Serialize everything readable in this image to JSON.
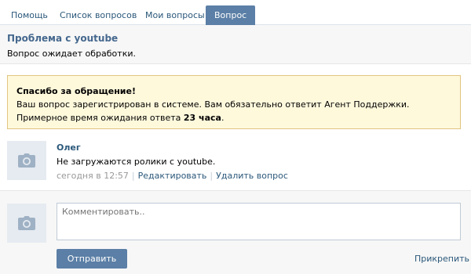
{
  "tabs": [
    {
      "label": "Помощь"
    },
    {
      "label": "Список вопросов"
    },
    {
      "label": "Мои вопросы"
    },
    {
      "label": "Вопрос"
    }
  ],
  "question": {
    "title": "Проблема с youtube",
    "status": "Вопрос ожидает обработки."
  },
  "notice": {
    "title": "Спасибо за обращение!",
    "line1": "Ваш вопрос зарегистрирован в системе. Вам обязательно ответит Агент Поддержки.",
    "line2_prefix": "Примерное время ожидания ответа ",
    "line2_bold": "23 часа",
    "line2_suffix": "."
  },
  "message": {
    "author": "Олег",
    "text": "Не загружаются ролики с youtube.",
    "time": "сегодня в 12:57",
    "edit_label": "Редактировать",
    "delete_label": "Удалить вопрос"
  },
  "comment": {
    "placeholder": "Комментировать..",
    "send_label": "Отправить",
    "attach_label": "Прикрепить"
  },
  "icons": {
    "avatar": "camera-icon"
  },
  "colors": {
    "accent": "#5b7fa6",
    "link": "#2b587a",
    "notice_bg": "#fff9dc",
    "notice_border": "#e2c481"
  }
}
